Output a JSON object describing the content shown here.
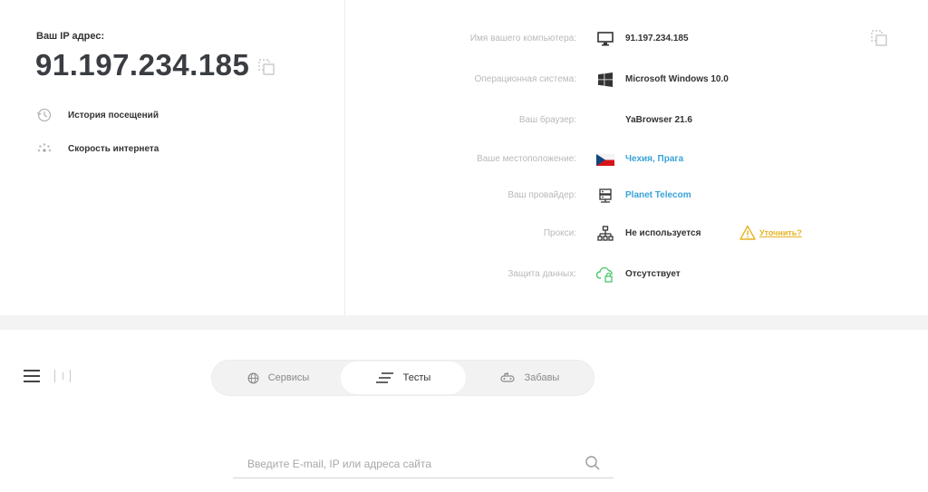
{
  "ip_panel": {
    "label": "Ваш IP адрес:",
    "value": "91.197.234.185"
  },
  "side_links": {
    "history": "История посещений",
    "speed": "Скорость интернета"
  },
  "info": {
    "computer_name": {
      "label": "Имя вашего компьютера:",
      "value": "91.197.234.185",
      "icon": "monitor-icon"
    },
    "os": {
      "label": "Операционная система:",
      "value": "Microsoft Windows 10.0",
      "icon": "windows-icon"
    },
    "browser": {
      "label": "Ваш браузер:",
      "value": "YaBrowser 21.6"
    },
    "location": {
      "label": "Ваше местоположение:",
      "value": "Чехия, Прага",
      "icon": "czech-flag-icon"
    },
    "provider": {
      "label": "Ваш провайдер:",
      "value": "Planet Telecom",
      "icon": "server-icon"
    },
    "proxy": {
      "label": "Прокси:",
      "value": "Не используется",
      "icon": "network-icon",
      "clarify": "Уточнить?"
    },
    "protection": {
      "label": "Защита данных:",
      "value": "Отсутствует",
      "icon": "cloud-lock-icon"
    }
  },
  "tabs": [
    {
      "label": "Сервисы",
      "icon": "globe-icon"
    },
    {
      "label": "Тесты",
      "icon": "lines-icon",
      "active": true
    },
    {
      "label": "Забавы",
      "icon": "toy-icon"
    }
  ],
  "search": {
    "placeholder": "Введите E-mail, IP или адреса сайта"
  },
  "colors": {
    "link": "#3aa3d8",
    "warning": "#e6b221",
    "label": "#b9b9b9",
    "secure_green": "#4cc76b"
  }
}
